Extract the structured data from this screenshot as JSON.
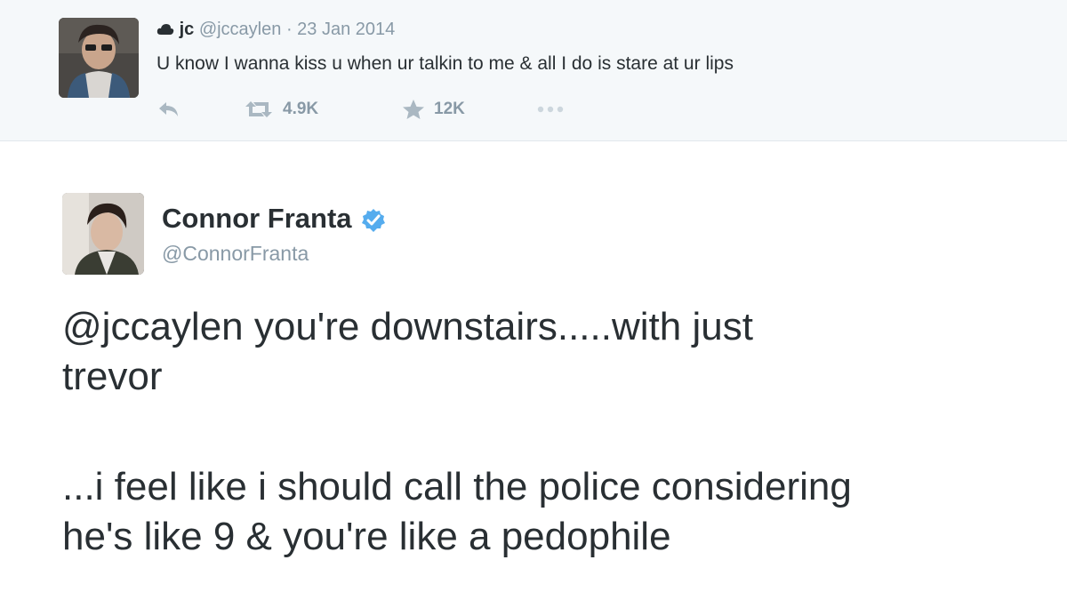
{
  "quoted_tweet": {
    "name": "jc",
    "name_icon": "cloud-icon",
    "handle": "@jccaylen",
    "separator": "·",
    "date": "23 Jan 2014",
    "text": "U know I wanna kiss u when ur talkin to me & all I do is stare at ur lips",
    "actions": {
      "reply_icon": "reply-icon",
      "retweet_icon": "retweet-icon",
      "retweet_count": "4.9K",
      "favorite_icon": "star-icon",
      "favorite_count": "12K",
      "more_icon": "more-icon"
    }
  },
  "main_tweet": {
    "name": "Connor Franta",
    "verified_icon": "verified-badge-icon",
    "handle": "@ConnorFranta",
    "text_lines": [
      "@jccaylen you're downstairs.....with just",
      "trevor",
      "...i feel like i should call the police considering",
      "he's like 9 & you're like a pedophile"
    ]
  },
  "colors": {
    "text": "#292f33",
    "muted": "#8899a6",
    "icon": "#aab8c2",
    "verified": "#55acee",
    "quoted_bg": "#f5f8fa"
  }
}
